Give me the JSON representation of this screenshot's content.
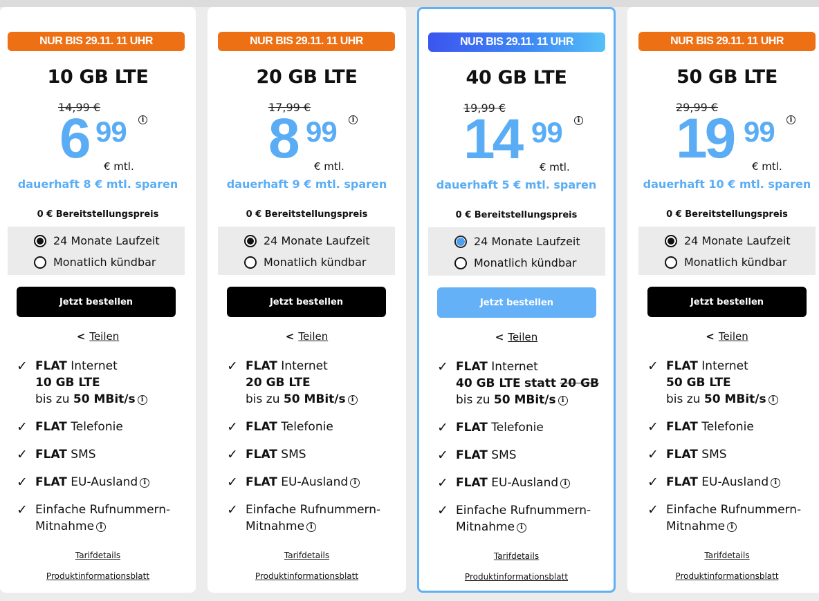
{
  "common": {
    "setup": "0 € Bereitstellungspreis",
    "opt1": "24 Monate Laufzeit",
    "opt2": "Monatlich kündbar",
    "button": "Jetzt bestellen",
    "share": "Teilen",
    "mtl": "€ mtl.",
    "flat": "FLAT",
    "internet": "Internet",
    "speed_pre": "bis zu",
    "speed": "50 MBit/s",
    "telefonie": "Telefonie",
    "sms": "SMS",
    "eu": "EU-Ausland",
    "rufnr1": "Einfache Rufnummern-",
    "rufnr2": "Mitnahme",
    "tarif": "Tarifdetails",
    "pib": "Produktinformationsblatt"
  },
  "cards": [
    {
      "badge": "NUR BIS 29.11. 11 UHR",
      "title": "10 GB LTE",
      "old": "14,99 €",
      "euro": "6",
      "cents": "99",
      "save": "dauerhaft 8 € mtl. sparen",
      "gb": "10 GB LTE",
      "gb_extra": "",
      "gb_strike": ""
    },
    {
      "badge": "NUR BIS 29.11. 11 UHR",
      "title": "20 GB LTE",
      "old": "17,99 €",
      "euro": "8",
      "cents": "99",
      "save": "dauerhaft 9 € mtl. sparen",
      "gb": "20 GB LTE",
      "gb_extra": "",
      "gb_strike": ""
    },
    {
      "badge": "NUR BIS 29.11. 11 UHR",
      "title": "40 GB LTE",
      "old": "19,99 €",
      "euro": "14",
      "cents": "99",
      "save": "dauerhaft 5 € mtl. sparen",
      "gb": "40 GB LTE",
      "gb_extra": "statt",
      "gb_strike": "20 GB"
    },
    {
      "badge": "NUR BIS 29.11. 11 UHR",
      "title": "50 GB LTE",
      "old": "29,99 €",
      "euro": "19",
      "cents": "99",
      "save": "dauerhaft 10 € mtl. sparen",
      "gb": "50 GB LTE",
      "gb_extra": "",
      "gb_strike": ""
    }
  ],
  "colors": {
    "orange": "#ee7015",
    "blue_price": "#5aadf5",
    "highlight_border": "#5fb0f5"
  }
}
